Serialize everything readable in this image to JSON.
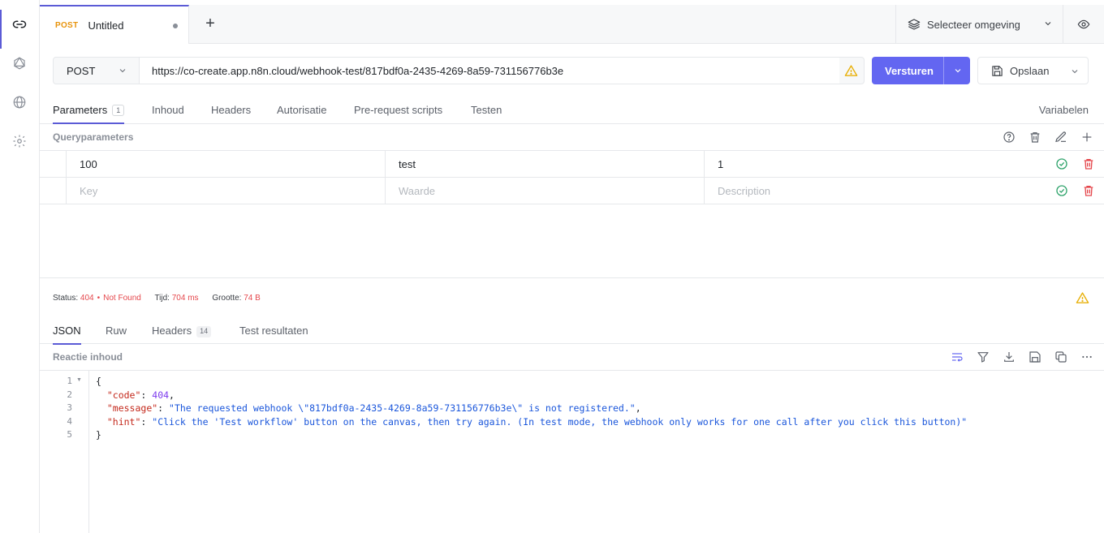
{
  "tab": {
    "method": "POST",
    "title": "Untitled",
    "add": "+"
  },
  "environment": {
    "label": "Selecteer omgeving"
  },
  "request": {
    "method": "POST",
    "url": "https://co-create.app.n8n.cloud/webhook-test/817bdf0a-2435-4269-8a59-731156776b3e",
    "send_label": "Versturen",
    "save_label": "Opslaan"
  },
  "request_tabs": [
    {
      "label": "Parameters",
      "badge": "1"
    },
    {
      "label": "Inhoud"
    },
    {
      "label": "Headers"
    },
    {
      "label": "Autorisatie"
    },
    {
      "label": "Pre-request scripts"
    },
    {
      "label": "Testen"
    }
  ],
  "variables_label": "Variabelen",
  "query": {
    "title": "Queryparameters",
    "rows": [
      {
        "key": "100",
        "value": "test",
        "description": "1"
      }
    ],
    "placeholders": {
      "key": "Key",
      "value": "Waarde",
      "description": "Description"
    }
  },
  "response": {
    "status_label": "Status:",
    "status_code": "404",
    "status_dot": "•",
    "status_text": "Not Found",
    "time_label": "Tijd:",
    "time_value": "704 ms",
    "size_label": "Grootte:",
    "size_value": "74 B",
    "tabs": [
      {
        "label": "JSON"
      },
      {
        "label": "Ruw"
      },
      {
        "label": "Headers",
        "badge": "14"
      },
      {
        "label": "Test resultaten"
      }
    ],
    "body_title": "Reactie inhoud",
    "line_numbers": [
      "1",
      "2",
      "3",
      "4",
      "5"
    ],
    "json": {
      "open": "{",
      "code_key": "\"code\"",
      "code_value": "404",
      "message_key": "\"message\"",
      "message_value": "\"The requested webhook \\\"817bdf0a-2435-4269-8a59-731156776b3e\\\" is not registered.\"",
      "hint_key": "\"hint\"",
      "hint_value": "\"Click the 'Test workflow' button on the canvas, then try again. (In test mode, the webhook only works for one call after you click this button)\"",
      "close": "}"
    }
  },
  "colors": {
    "accent": "#6366f1",
    "error": "#e5484d",
    "success": "#30a46c",
    "warning": "#e8b10c",
    "method_tab": "#e8940c"
  }
}
